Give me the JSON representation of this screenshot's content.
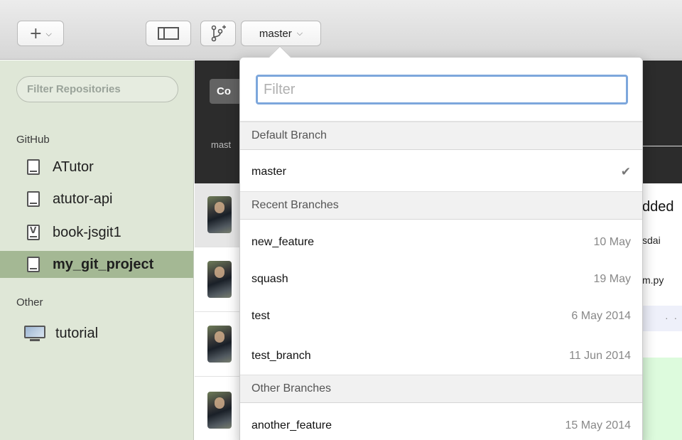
{
  "toolbar": {
    "add_glyph": "+",
    "chevron": "⌵",
    "branch_glyph": "⑂",
    "current_branch": "master"
  },
  "sidebar": {
    "filter_placeholder": "Filter Repositories",
    "github_label": "GitHub",
    "github_repos": [
      {
        "name": "ATutor"
      },
      {
        "name": "atutor-api"
      },
      {
        "name": "book-jsgit1"
      },
      {
        "name": "my_git_project",
        "selected": true
      }
    ],
    "other_label": "Other",
    "other_repos": [
      {
        "name": "tutorial"
      }
    ]
  },
  "main": {
    "tab_label": "Co",
    "branch_label": "mast",
    "peek": {
      "title_fragment": "dded",
      "author_fragment": "sdai",
      "file_fragment": "m.py",
      "dots": "· ·"
    }
  },
  "branch_menu": {
    "filter_placeholder": "Filter",
    "default_section": "Default Branch",
    "default_branch": {
      "name": "master",
      "check": "✔"
    },
    "recent_section": "Recent Branches",
    "recent": [
      {
        "name": "new_feature",
        "date": "10 May"
      },
      {
        "name": "squash",
        "date": "19 May"
      },
      {
        "name": "test",
        "date": "6 May 2014"
      },
      {
        "name": "test_branch",
        "date": "11 Jun 2014"
      }
    ],
    "other_section": "Other Branches",
    "other": [
      {
        "name": "another_feature",
        "date": "15 May 2014"
      }
    ]
  },
  "colors": {
    "sidebar_bg": "#dfe7d7",
    "selected_bg": "#a4b894",
    "header_bg": "#2c2c2c",
    "focus_ring": "#7da7dc"
  }
}
